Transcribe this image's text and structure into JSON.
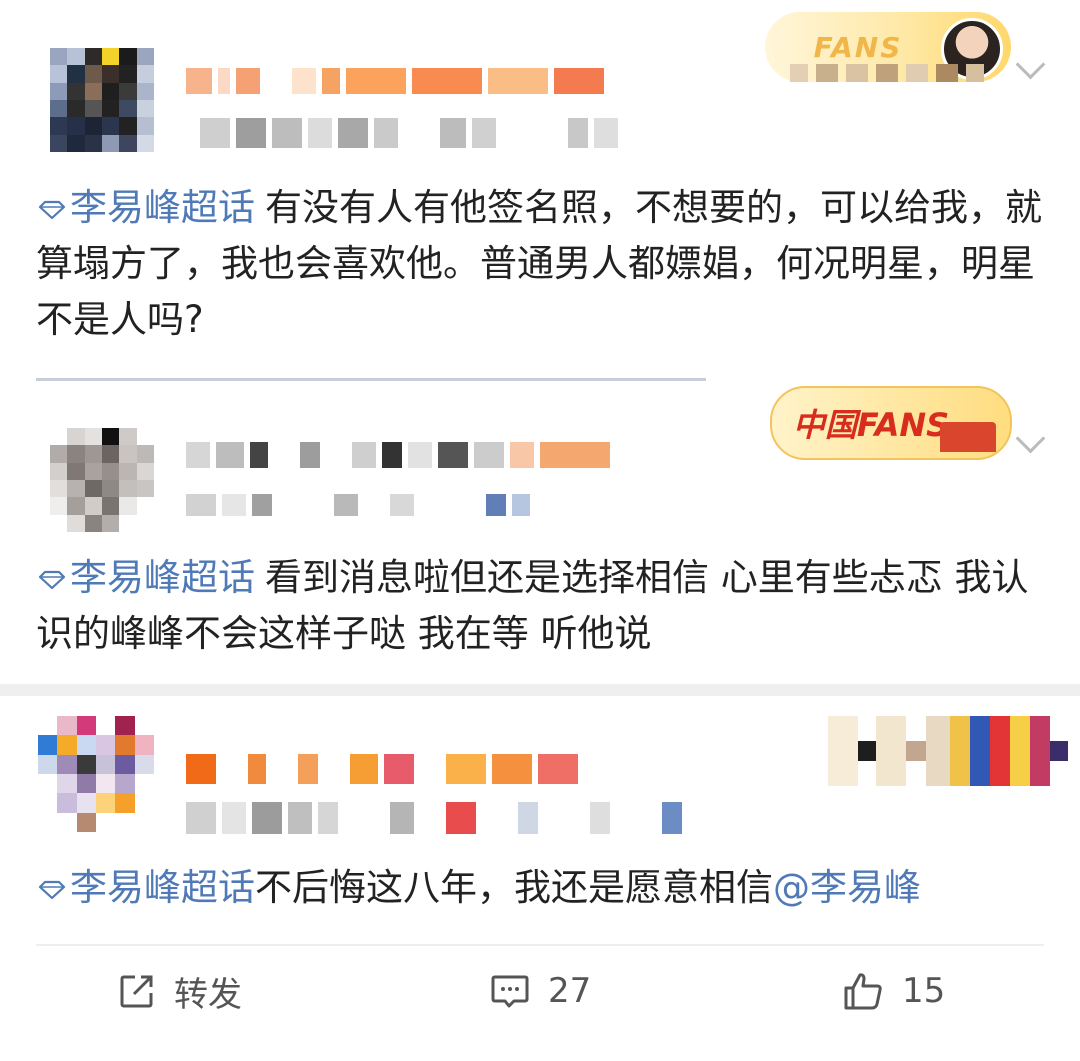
{
  "posts": [
    {
      "badge_text": "FANS",
      "topic": "李易峰超话",
      "text": "有没有人有他签名照，不想要的，可以给我，就算塌方了，我也会喜欢他。普通男人都嫖娼，何况明星，明星不是人吗?"
    },
    {
      "badge_text": "中国FANS",
      "topic": "李易峰超话",
      "text": "看到消息啦但还是选择相信 心里有些忐忑 我认识的峰峰不会这样子哒 我在等 听他说"
    },
    {
      "topic": "李易峰超话",
      "text": "不后悔这八年，我还是愿意相信",
      "mention": "@李易峰"
    }
  ],
  "actions": {
    "repost_label": "转发",
    "comment_count": "27",
    "like_count": "15"
  },
  "colors": {
    "topic_blue": "#4f7ab7",
    "body_text": "#222222",
    "separator": "#efefef"
  },
  "icons": [
    "topic-diamond-icon",
    "chevron-down-icon",
    "repost-icon",
    "comment-icon",
    "like-icon"
  ]
}
